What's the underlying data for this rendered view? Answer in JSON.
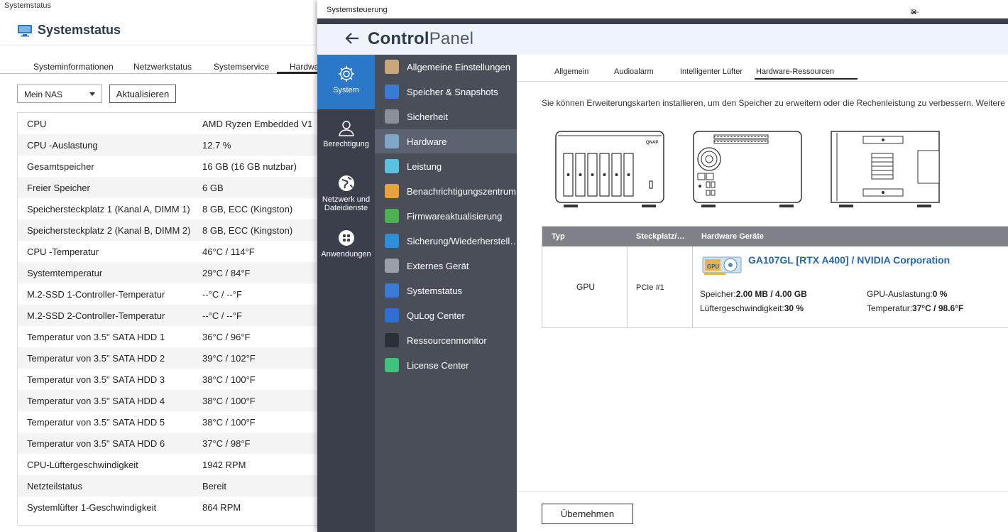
{
  "systemstatus": {
    "window_title": "Systemstatus",
    "heading": "Systemstatus",
    "tabs": [
      "Systeminformationen",
      "Netzwerkstatus",
      "Systemservice",
      "Hardwar"
    ],
    "nas_select": "Mein NAS",
    "refresh_label": "Aktualisieren",
    "rows": [
      {
        "k": "CPU",
        "v": "AMD Ryzen Embedded V1"
      },
      {
        "k": "CPU -Auslastung",
        "v": "12.7 %"
      },
      {
        "k": "Gesamtspeicher",
        "v": "16 GB (16 GB nutzbar)"
      },
      {
        "k": "Freier Speicher",
        "v": "6 GB"
      },
      {
        "k": "Speichersteckplatz 1 (Kanal A, DIMM 1)",
        "v": "8 GB, ECC (Kingston)"
      },
      {
        "k": "Speichersteckplatz 2 (Kanal B, DIMM 2)",
        "v": "8 GB, ECC (Kingston)"
      },
      {
        "k": "CPU -Temperatur",
        "v": "46°C / 114°F"
      },
      {
        "k": "Systemtemperatur",
        "v": "29°C / 84°F"
      },
      {
        "k": "M.2-SSD 1-Controller-Temperatur",
        "v": "--°C / --°F"
      },
      {
        "k": "M.2-SSD 2-Controller-Temperatur",
        "v": "--°C / --°F"
      },
      {
        "k": "Temperatur von 3.5\" SATA HDD 1",
        "v": "36°C / 96°F"
      },
      {
        "k": "Temperatur von 3.5\" SATA HDD 2",
        "v": "39°C / 102°F"
      },
      {
        "k": "Temperatur von 3.5\" SATA HDD 3",
        "v": "38°C / 100°F"
      },
      {
        "k": "Temperatur von 3.5\" SATA HDD 4",
        "v": "38°C / 100°F"
      },
      {
        "k": "Temperatur von 3.5\" SATA HDD 5",
        "v": "38°C / 100°F"
      },
      {
        "k": "Temperatur von 3.5\" SATA HDD 6",
        "v": "37°C / 98°F"
      },
      {
        "k": "CPU-Lüftergeschwindigkeit",
        "v": "1942 RPM"
      },
      {
        "k": "Netzteilstatus",
        "v": "Bereit"
      },
      {
        "k": "Systemlüfter 1-Geschwindigkeit",
        "v": "864 RPM"
      }
    ]
  },
  "controlpanel": {
    "window_title": "Systemsteuerung",
    "brand_bold": "Control",
    "brand_light": "Panel",
    "categories": [
      {
        "label": "System",
        "icon": "gear-icon"
      },
      {
        "label": "Berechtigung",
        "icon": "user-icon"
      },
      {
        "label": "Netzwerk und Dateidienste",
        "icon": "globe-icon"
      },
      {
        "label": "Anwendungen",
        "icon": "apps-icon"
      }
    ],
    "menu": [
      {
        "label": "Allgemeine Einstellungen",
        "color": "#c9a77a"
      },
      {
        "label": "Speicher & Snapshots",
        "color": "#3a7bd5"
      },
      {
        "label": "Sicherheit",
        "color": "#8a8f99"
      },
      {
        "label": "Hardware",
        "color": "#7ea7c9"
      },
      {
        "label": "Leistung",
        "color": "#5bc0de"
      },
      {
        "label": "Benachrichtigungszentrum",
        "color": "#e8a33a"
      },
      {
        "label": "Firmwareaktualisierung",
        "color": "#4caf50"
      },
      {
        "label": "Sicherung/Wiederherstell…",
        "color": "#2f8fd8"
      },
      {
        "label": "Externes Gerät",
        "color": "#9aa0a8"
      },
      {
        "label": "Systemstatus",
        "color": "#3a7bd5"
      },
      {
        "label": "QuLog Center",
        "color": "#2f6fd0"
      },
      {
        "label": "Ressourcenmonitor",
        "color": "#2b2f36"
      },
      {
        "label": "License Center",
        "color": "#3cc47c"
      }
    ],
    "tabs": [
      "Allgemein",
      "Audioalarm",
      "Intelligenter Lüfter",
      "Hardware-Ressourcen"
    ],
    "intro": "Sie können Erweiterungskarten installieren, um den Speicher zu erweitern oder die Rechenleistung zu verbessern. Weitere In",
    "device_logo": "QNAP",
    "table": {
      "headers": [
        "Typ",
        "Steckplatz/…",
        "Hardware Geräte"
      ],
      "type": "GPU",
      "slot": "PCIe #1",
      "device_name": "GA107GL [RTX A400] / NVIDIA Corporation",
      "gpu_icon_label": "GPU",
      "specs": {
        "mem_label": "Speicher:",
        "mem_value": "2.00 MB / 4.00 GB",
        "load_label": "GPU-Auslastung:",
        "load_value": "0 %",
        "fan_label": "Lüftergeschwindigkeit:",
        "fan_value": "30 %",
        "temp_label": "Temperatur:",
        "temp_value": "37°C / 98.6°F"
      }
    },
    "apply_label": "Übernehmen"
  }
}
